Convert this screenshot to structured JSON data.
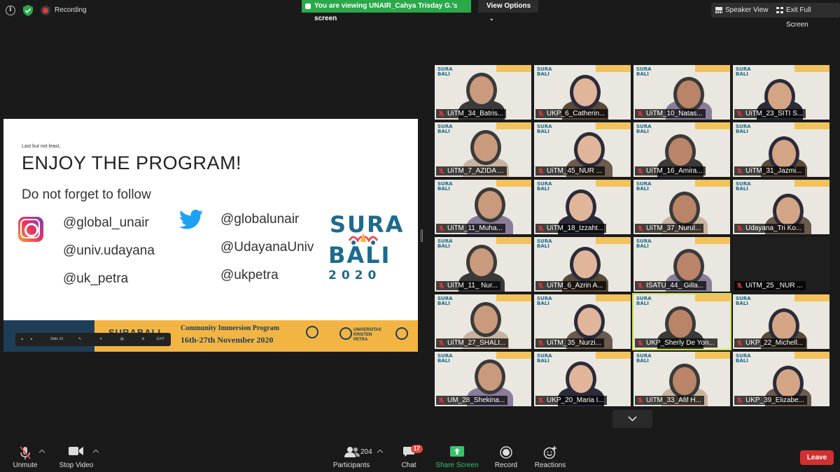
{
  "topbar": {
    "recording_label": "Recording",
    "viewing_banner": "You are viewing UNAIR_Cahya Trisday G.'s screen",
    "view_options": "View Options",
    "speaker_view": "Speaker View",
    "exit_full_screen": "Exit Full Screen"
  },
  "slide": {
    "kicker": "Last but not least,",
    "title": "ENJOY THE PROGRAM!",
    "follow": "Do not forget to follow",
    "instagram_handles": [
      "@global_unair",
      "@univ.udayana",
      "@uk_petra"
    ],
    "twitter_handles": [
      "@globalunair",
      "@UdayanaUniv",
      "@ukpetra"
    ],
    "logo": {
      "top": "SURA",
      "bottom": "BALI",
      "year": "2020"
    },
    "footer": {
      "banner": "SURABALI",
      "program": "Community Immersion Program",
      "dates": "16th-27th November 2020",
      "partner": "UNIVERSITAS KRISTEN PETRA"
    },
    "toolbar": {
      "slide": "Slide 13",
      "exit": "EXIT"
    }
  },
  "participants": [
    {
      "name": "UiTM_34_Batris..."
    },
    {
      "name": "UKP_6_Catherin..."
    },
    {
      "name": "UiTM_10_Natas..."
    },
    {
      "name": "UiTM_23_SITI S..."
    },
    {
      "name": "UiTM_7_AZIDA ..."
    },
    {
      "name": "UiTM_45_NUR ..."
    },
    {
      "name": "UiTM_16_Amira..."
    },
    {
      "name": "UiTM_31_Jazmi..."
    },
    {
      "name": "UiTM_11_Muha..."
    },
    {
      "name": "UiTM_18_Izzaht..."
    },
    {
      "name": "UiTM_37_Nurul..."
    },
    {
      "name": "Udayana_Tri Ko..."
    },
    {
      "name": "UiTM_11_ Nur..."
    },
    {
      "name": "UiTM_6_Azrin A..."
    },
    {
      "name": "ISATU_44_ Gilla..."
    },
    {
      "name": "UiTM_25 _NUR ..."
    },
    {
      "name": "UiTM_27_SHALI..."
    },
    {
      "name": "UiTM_35_Nurzi..."
    },
    {
      "name": "UKP_Sherly De Yon..."
    },
    {
      "name": "UKP_22_Michell..."
    },
    {
      "name": "UM_28_Shekina..."
    },
    {
      "name": "UKP_20_Maria I..."
    },
    {
      "name": "UiTM_33_Afif H..."
    },
    {
      "name": "UKP_39_Elizabe..."
    }
  ],
  "toolbar": {
    "unmute": "Unmute",
    "stop_video": "Stop Video",
    "participants": "Participants",
    "participant_count": "204",
    "chat": "Chat",
    "chat_badge": "17",
    "share_screen": "Share Screen",
    "record": "Record",
    "reactions": "Reactions",
    "leave": "Leave"
  },
  "colors": {
    "share_green": "#35c46c",
    "viewing_banner": "#2aa84a",
    "leave_red": "#d13030",
    "active_speaker": "#c6de4c"
  }
}
